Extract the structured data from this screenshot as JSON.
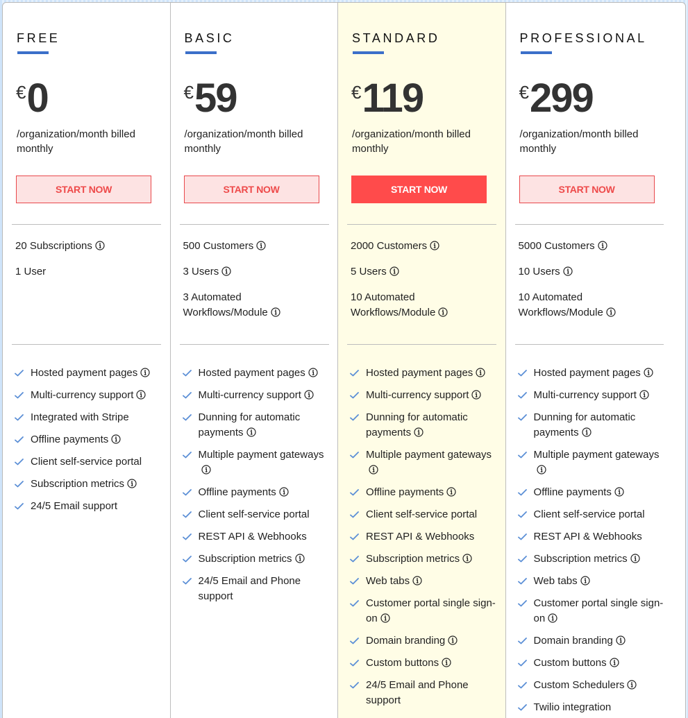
{
  "colors": {
    "accent_bar": "#3b6fc9",
    "cta_red": "#ff4b4b",
    "cta_light_bg": "#fde3e3",
    "highlight_bg": "#fffde6",
    "check_blue": "#5b8fd6"
  },
  "plans": [
    {
      "name": "FREE",
      "currency": "€",
      "price": "0",
      "billing": "/organization/month billed monthly",
      "cta": "START NOW",
      "highlighted": false,
      "limits": [
        {
          "text": "20 Subscriptions",
          "info": true
        },
        {
          "text": "1 User",
          "info": false
        }
      ],
      "features": [
        {
          "text": "Hosted payment pages",
          "info": true
        },
        {
          "text": "Multi-currency support",
          "info": true
        },
        {
          "text": "Integrated with Stripe",
          "info": false
        },
        {
          "text": "Offline payments",
          "info": true
        },
        {
          "text": "Client self-service portal",
          "info": false
        },
        {
          "text": "Subscription metrics",
          "info": true
        },
        {
          "text": "24/5 Email support",
          "info": false
        }
      ]
    },
    {
      "name": "BASIC",
      "currency": "€",
      "price": "59",
      "billing": "/organization/month billed monthly",
      "cta": "START NOW",
      "highlighted": false,
      "limits": [
        {
          "text": "500 Customers",
          "info": true
        },
        {
          "text": "3 Users",
          "info": true
        },
        {
          "text": "3 Automated Workflows/Module",
          "info": true
        }
      ],
      "features": [
        {
          "text": "Hosted payment pages",
          "info": true
        },
        {
          "text": "Multi-currency support",
          "info": true
        },
        {
          "text": "Dunning for automatic payments",
          "info": true
        },
        {
          "text": "Multiple payment gateways",
          "info": true
        },
        {
          "text": "Offline payments",
          "info": true
        },
        {
          "text": "Client self-service portal",
          "info": false
        },
        {
          "text": "REST API & Webhooks",
          "info": false
        },
        {
          "text": "Subscription metrics",
          "info": true
        },
        {
          "text": "24/5 Email and Phone support",
          "info": false
        }
      ]
    },
    {
      "name": "STANDARD",
      "currency": "€",
      "price": "119",
      "billing": "/organization/month billed monthly",
      "cta": "START NOW",
      "highlighted": true,
      "limits": [
        {
          "text": "2000 Customers",
          "info": true
        },
        {
          "text": "5 Users",
          "info": true
        },
        {
          "text": "10 Automated Workflows/Module",
          "info": true
        }
      ],
      "features": [
        {
          "text": "Hosted payment pages",
          "info": true
        },
        {
          "text": "Multi-currency support",
          "info": true
        },
        {
          "text": "Dunning for automatic payments",
          "info": true
        },
        {
          "text": "Multiple payment gateways",
          "info": true
        },
        {
          "text": "Offline payments",
          "info": true
        },
        {
          "text": "Client self-service portal",
          "info": false
        },
        {
          "text": "REST API & Webhooks",
          "info": false
        },
        {
          "text": "Subscription metrics",
          "info": true
        },
        {
          "text": "Web tabs",
          "info": true
        },
        {
          "text": "Customer portal single sign-on",
          "info": true
        },
        {
          "text": "Domain branding",
          "info": true
        },
        {
          "text": "Custom buttons",
          "info": true
        },
        {
          "text": "24/5 Email and Phone support",
          "info": false
        }
      ]
    },
    {
      "name": "PROFESSIONAL",
      "currency": "€",
      "price": "299",
      "billing": "/organization/month billed monthly",
      "cta": "START NOW",
      "highlighted": false,
      "limits": [
        {
          "text": "5000 Customers",
          "info": true
        },
        {
          "text": "10 Users",
          "info": true
        },
        {
          "text": "10 Automated Workflows/Module",
          "info": true
        }
      ],
      "features": [
        {
          "text": "Hosted payment pages",
          "info": true
        },
        {
          "text": "Multi-currency support",
          "info": true
        },
        {
          "text": "Dunning for automatic payments",
          "info": true
        },
        {
          "text": "Multiple payment gateways",
          "info": true
        },
        {
          "text": "Offline payments",
          "info": true
        },
        {
          "text": "Client self-service portal",
          "info": false
        },
        {
          "text": "REST API & Webhooks",
          "info": false
        },
        {
          "text": "Subscription metrics",
          "info": true
        },
        {
          "text": "Web tabs",
          "info": true
        },
        {
          "text": "Customer portal single sign-on",
          "info": true
        },
        {
          "text": "Domain branding",
          "info": true
        },
        {
          "text": "Custom buttons",
          "info": true
        },
        {
          "text": "Custom Schedulers",
          "info": true
        },
        {
          "text": "Twilio integration",
          "info": false
        }
      ]
    }
  ]
}
